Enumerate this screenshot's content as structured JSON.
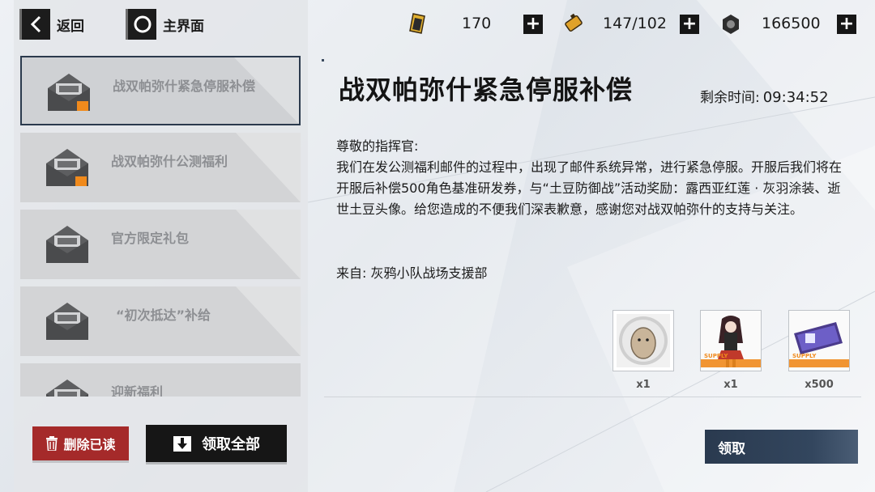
{
  "topbar": {
    "back_label": "返回",
    "home_label": "主界面",
    "resources": [
      {
        "icon": "gold-card-icon",
        "value": "170"
      },
      {
        "icon": "battery-icon",
        "value": "147/102"
      },
      {
        "icon": "gear-nut-icon",
        "value": "166500"
      }
    ],
    "plus_label": "+"
  },
  "mail_list": {
    "items": [
      {
        "title": "战双帕弥什紧急停服补偿",
        "has_attachment": true,
        "selected": true
      },
      {
        "title": "战双帕弥什公测福利",
        "has_attachment": true,
        "selected": false
      },
      {
        "title": "官方限定礼包",
        "has_attachment": false,
        "selected": false
      },
      {
        "title": "“初次抵达”补给",
        "has_attachment": false,
        "selected": false
      },
      {
        "title": "迎新福利",
        "has_attachment": false,
        "selected": false
      }
    ]
  },
  "buttons": {
    "delete_read": "删除已读",
    "claim_all": "领取全部",
    "claim": "领取"
  },
  "detail": {
    "title": "战双帕弥什紧急停服补偿",
    "timer_label": "剩余时间:",
    "timer_value": "09:34:52",
    "greeting": "尊敬的指挥官:",
    "body": "我们在发公测福利邮件的过程中，出现了邮件系统异常，进行紧急停服。开服后我们将在开服后补偿500角色基准研发券，与“土豆防御战”活动奖励：露西亚红莲 · 灰羽涂装、逝世土豆头像。给您造成的不便我们深表歉意，感谢您对战双帕弥什的支持与关注。",
    "sender": "来自: 灰鸦小队战场支援部",
    "rewards": [
      {
        "name": "potato-avatar",
        "qty": "x1"
      },
      {
        "name": "lucia-coating",
        "qty": "x1",
        "tag": "SUPPLY"
      },
      {
        "name": "research-ticket",
        "qty": "x500",
        "tag": "SUPPLY"
      }
    ]
  },
  "colors": {
    "accent_dark": "#161616",
    "delete_red": "#a52a2a",
    "claim_navy": "#2a3a4f",
    "supply_orange": "#f08a1c"
  }
}
